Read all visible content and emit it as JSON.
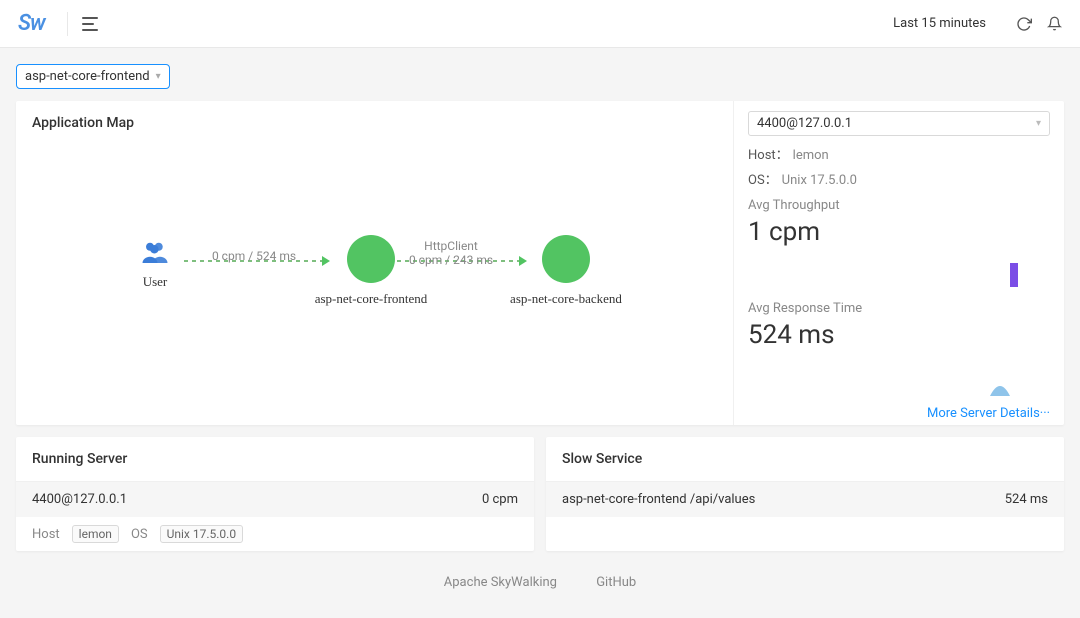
{
  "header": {
    "logo": "Sw",
    "timeRange": "Last 15 minutes"
  },
  "serviceSelect": "asp-net-core-frontend",
  "appMap": {
    "title": "Application Map",
    "nodes": {
      "user": {
        "label": "User"
      },
      "frontend": {
        "label": "asp-net-core-frontend"
      },
      "backend": {
        "label": "asp-net-core-backend"
      }
    },
    "edges": {
      "userToFrontend": {
        "label": "0 cpm / 524 ms"
      },
      "frontendToBackend": {
        "labelTop": "HttpClient",
        "labelBottom": "0 cpm / 243 ms"
      }
    }
  },
  "serverDetail": {
    "instance": "4400@127.0.0.1",
    "hostLabel": "Host：",
    "host": "lemon",
    "osLabel": "OS：",
    "os": "Unix 17.5.0.0",
    "throughputLabel": "Avg Throughput",
    "throughputValue": "1 cpm",
    "responseLabel": "Avg Response Time",
    "responseValue": "524 ms",
    "moreLink": "More Server Details···"
  },
  "runningServer": {
    "title": "Running Server",
    "instance": "4400@127.0.0.1",
    "throughput": "0 cpm",
    "hostLabel": "Host",
    "hostTag": "lemon",
    "osLabel": "OS",
    "osTag": "Unix 17.5.0.0"
  },
  "slowService": {
    "title": "Slow Service",
    "endpoint": "asp-net-core-frontend /api/values",
    "latency": "524 ms"
  },
  "footer": {
    "link1": "Apache SkyWalking",
    "link2": "GitHub"
  }
}
